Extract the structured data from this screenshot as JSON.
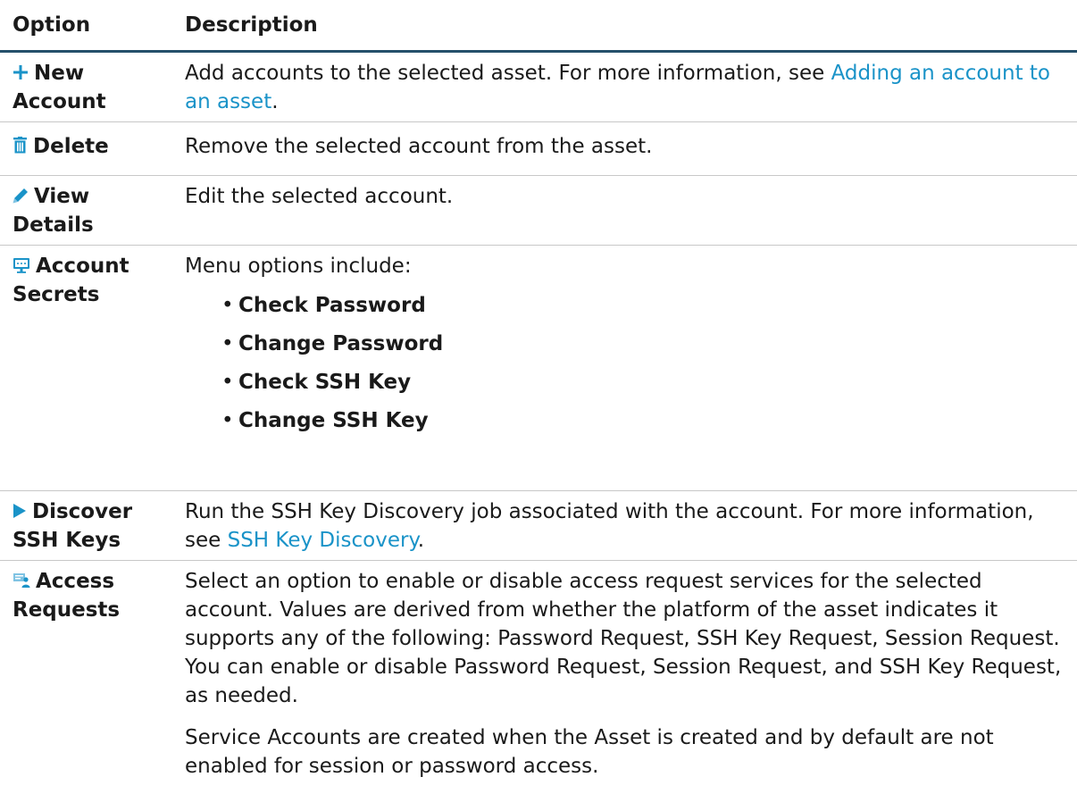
{
  "header": {
    "option": "Option",
    "description": "Description"
  },
  "rows": [
    {
      "icon": "plus-icon",
      "label_line1": "New",
      "label_line2": "Account",
      "desc_text": "Add accounts to the selected asset. For more information, see ",
      "desc_link": "Adding an account to an asset",
      "desc_tail": "."
    },
    {
      "icon": "trash-icon",
      "label_line1": "Delete",
      "desc_text": "Remove the selected account from the asset."
    },
    {
      "icon": "pencil-icon",
      "label_line1": "View",
      "label_line2": "Details",
      "desc_text": "Edit the selected account."
    },
    {
      "icon": "monitor-icon",
      "label_line1": "Account",
      "label_line2": "Secrets",
      "desc_text": "Menu options include:",
      "bullets": [
        "Check Password",
        "Change Password",
        "Check SSH Key",
        "Change SSH Key"
      ]
    },
    {
      "icon": "play-icon",
      "label_line1": "Discover",
      "label_line2": "SSH Keys",
      "desc_text": "Run the SSH Key Discovery job associated with the account. For more information, see ",
      "desc_link": "SSH Key Discovery",
      "desc_tail": "."
    },
    {
      "icon": "access-request-icon",
      "label_line1": "Access",
      "label_line2": "Requests",
      "desc_text": "Select an option to enable or disable access request services for the selected account. Values are derived from whether the platform of the asset indicates it supports any of the following: Password Request, SSH Key Request, Session Request. You can enable or disable Password Request, Session Request, and SSH Key Request, as needed.",
      "desc_para2": "Service Accounts are created when the Asset is created and by default are not enabled for session or password access."
    }
  ],
  "colors": {
    "link": "#1a93c8",
    "header_rule": "#25506b",
    "icon_blue": "#1a93c8"
  }
}
